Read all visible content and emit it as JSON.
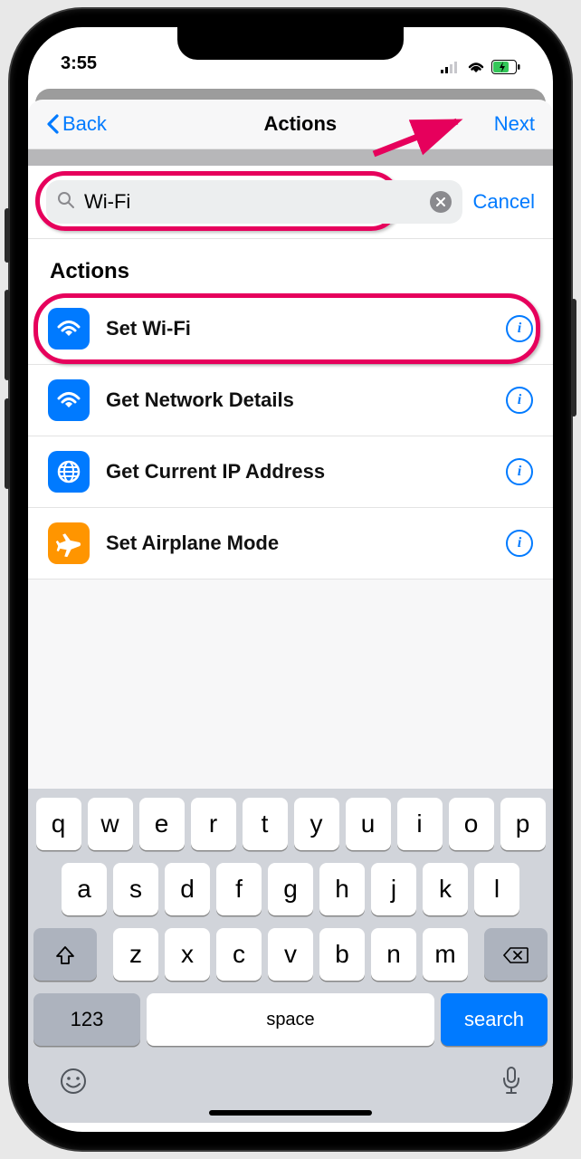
{
  "status": {
    "time": "3:55"
  },
  "nav": {
    "back": "Back",
    "title": "Actions",
    "next": "Next"
  },
  "search": {
    "value": "Wi-Fi",
    "cancel": "Cancel"
  },
  "section": {
    "title": "Actions"
  },
  "actions": [
    {
      "label": "Set Wi-Fi",
      "icon": "wifi",
      "color": "blue"
    },
    {
      "label": "Get Network Details",
      "icon": "wifi",
      "color": "blue"
    },
    {
      "label": "Get Current IP Address",
      "icon": "globe",
      "color": "blue"
    },
    {
      "label": "Set Airplane Mode",
      "icon": "airplane",
      "color": "orange"
    }
  ],
  "keyboard": {
    "rows": [
      [
        "q",
        "w",
        "e",
        "r",
        "t",
        "y",
        "u",
        "i",
        "o",
        "p"
      ],
      [
        "a",
        "s",
        "d",
        "f",
        "g",
        "h",
        "j",
        "k",
        "l"
      ],
      [
        "z",
        "x",
        "c",
        "v",
        "b",
        "n",
        "m"
      ]
    ],
    "num": "123",
    "space": "space",
    "search": "search"
  }
}
